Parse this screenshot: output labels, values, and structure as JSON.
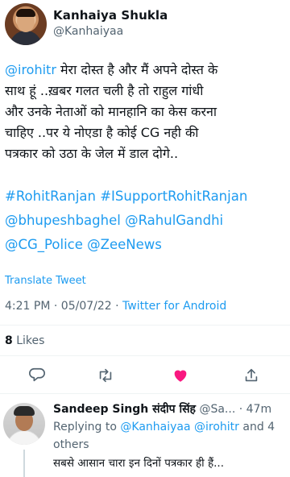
{
  "author": {
    "name": "Kanhaiya Shukla",
    "handle": "@Kanhaiyaa"
  },
  "tweet": {
    "mention": "@irohitr",
    "body_line1": " मेरा दोस्त है और मैं अपने दोस्त के",
    "body_line2": "साथ हूं ..ख़बर गलत चली है तो राहुल गांधी",
    "body_line3": "और उनके नेताओं को मानहानि का केस करना",
    "body_line4": "चाहिए ..पर ये नोएडा है कोई CG नही की",
    "body_line5": "पत्रकार को उठा के जेल में डाल दोगे..",
    "tags_line1": "#RohitRanjan #ISupportRohitRanjan",
    "tags_line2": "@bhupeshbaghel @RahulGandhi",
    "tags_line3": "@CG_Police @ZeeNews"
  },
  "translate_label": "Translate Tweet",
  "meta": {
    "time": "4:21 PM",
    "separator": " · ",
    "date": "05/07/22",
    "source": "Twitter for Android"
  },
  "stats": {
    "likes_count": "8",
    "likes_label": " Likes"
  },
  "icons": {
    "reply": "reply-icon",
    "retweet": "retweet-icon",
    "like": "heart-icon",
    "share": "share-icon"
  },
  "colors": {
    "accent": "#1d9bf0",
    "like": "#f91880",
    "muted": "#536471"
  },
  "reply": {
    "name": "Sandeep Singh संदीप सिंह",
    "handle": " @Sa...",
    "separator": " · ",
    "time": "47m",
    "replying_prefix": "Replying to ",
    "replying_mention1": "@Kanhaiyaa",
    "replying_mention2": " @irohitr",
    "replying_suffix": " and 4",
    "replying_line2": "others",
    "text": "सबसे आसान चारा इन दिनों पत्रकार ही हैं..."
  }
}
